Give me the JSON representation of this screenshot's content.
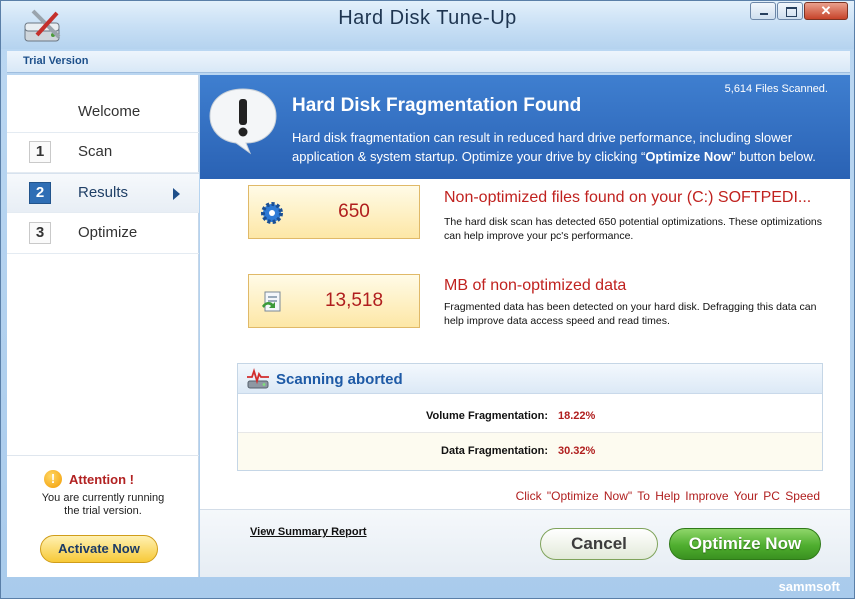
{
  "window": {
    "title": "Hard Disk Tune-Up",
    "trial_label": "Trial Version",
    "close_glyph": "✕",
    "icon": "hard-disk-wrench-icon"
  },
  "sidebar": {
    "items": [
      {
        "number": "",
        "label": "Welcome"
      },
      {
        "number": "1",
        "label": "Scan"
      },
      {
        "number": "2",
        "label": "Results",
        "active": true
      },
      {
        "number": "3",
        "label": "Optimize"
      }
    ],
    "attention_glyph": "!",
    "attention_title": "Attention !",
    "attention_text_line1": "You are currently running",
    "attention_text_line2": "the trial version.",
    "activate_label": "Activate Now"
  },
  "header": {
    "files_scanned": "5,614 Files Scanned.",
    "title": "Hard Disk Fragmentation Found",
    "desc_part1": "Hard disk fragmentation can result in reduced hard drive performance, including slower application & system startup. Optimize your drive by clicking “",
    "desc_bold": "Optimize Now",
    "desc_part2": "” button below.",
    "bubble_glyph": "!"
  },
  "stats": [
    {
      "value": "650",
      "icon": "gear-icon",
      "title": "Non-optimized files found on your (C:) SOFTPEDI...",
      "description": "The hard disk scan has detected 650 potential optimizations. These optimizations can help improve your pc's performance."
    },
    {
      "value": "13,518",
      "icon": "defrag-file-icon",
      "title": "MB of non-optimized data",
      "description": "Fragmented data has been detected on your hard disk. Defragging this data can help improve data access speed and read times."
    }
  ],
  "scan": {
    "title": "Scanning aborted",
    "rows": [
      {
        "label": "Volume Fragmentation:",
        "value": "18.22%"
      },
      {
        "label": "Data Fragmentation:",
        "value": "30.32%"
      }
    ]
  },
  "cta": "Click  \"Optimize Now\"  To Help Improve Your PC Speed",
  "footer": {
    "summary_link": "View Summary Report",
    "cancel_label": "Cancel",
    "optimize_label": "Optimize Now"
  },
  "brand": "sammsoft",
  "colors": {
    "header_blue": "#2a62b4",
    "accent_red": "#b01e1e",
    "optimize_green": "#4fae2f",
    "activate_gold": "#f7c938"
  }
}
